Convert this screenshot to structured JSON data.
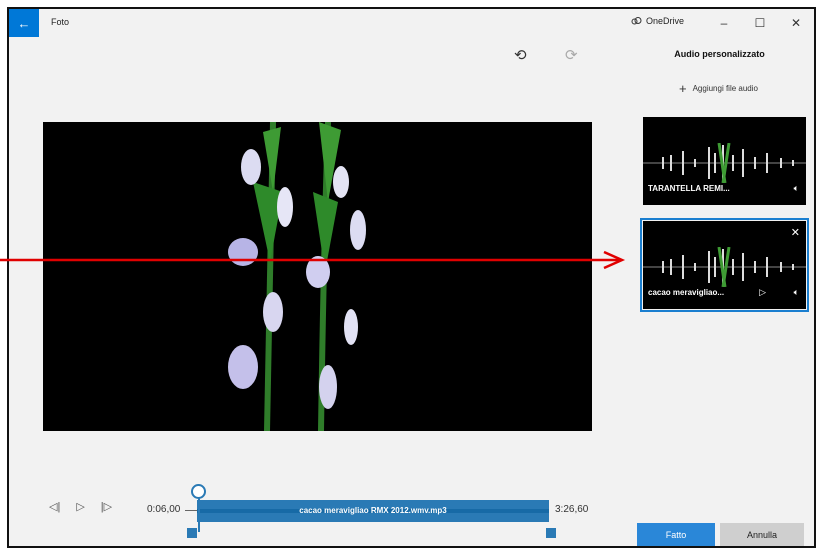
{
  "titlebar": {
    "back_icon": "back-arrow-icon",
    "app_title": "Foto",
    "onedrive_label": "OneDrive",
    "minimize": "–",
    "maximize": "☐",
    "close": "✕"
  },
  "toolbar": {
    "undo": "⟲",
    "redo": "⟳"
  },
  "timeline": {
    "start_time": "0:06,00",
    "end_time": "3:26,60",
    "track_name": "cacao meravigliao RMX 2012.wmv.mp3"
  },
  "playback": {
    "prev": "◁|",
    "play": "▷",
    "next": "|▷"
  },
  "panel": {
    "title": "Audio personalizzato",
    "add_audio_label": "Aggiungi file audio",
    "tracks": [
      {
        "label": "TARANTELLA REMI...",
        "volume_icon": "🔈︎"
      },
      {
        "label": "cacao meravigliao...",
        "volume_icon": "🔈︎",
        "play_icon": "▷",
        "close_icon": "✕"
      }
    ]
  },
  "actions": {
    "done": "Fatto",
    "cancel": "Annulla"
  },
  "colors": {
    "accent": "#2a87d8",
    "track": "#2a7ab5",
    "annotation": "#e00000"
  }
}
